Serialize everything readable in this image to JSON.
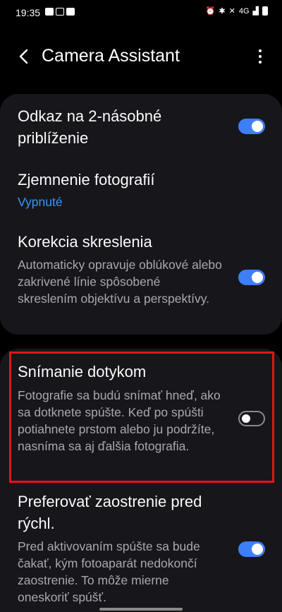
{
  "status_bar": {
    "time": "19:35",
    "network": "4G"
  },
  "header": {
    "title": "Camera Assistant"
  },
  "settings": [
    {
      "title": "Odkaz na 2-násobné priblíženie",
      "toggle": true
    },
    {
      "title": "Zjemnenie fotografií",
      "value": "Vypnuté"
    },
    {
      "title": "Korekcia skreslenia",
      "subtitle": "Automaticky opravuje oblúkové alebo zakrivené línie spôsobené skreslením objektívu a perspektívy.",
      "toggle": true
    },
    {
      "title": "Snímanie dotykom",
      "subtitle": "Fotografie sa budú snímať hneď, ako sa dotknete spúšte. Keď po spúšti potiahnete prstom alebo ju podržíte, nasníma sa aj ďalšia fotografia.",
      "toggle": false
    },
    {
      "title": "Preferovať zaostrenie pred rýchl.",
      "subtitle": "Pred aktivovaním spúšte sa bude čakať, kým fotoaparát nedokončí zaostrenie. To môže mierne oneskoriť spúšť.",
      "toggle": true
    }
  ],
  "colors": {
    "accent": "#3e7ef7",
    "value_text": "#3e91ff",
    "highlight": "#e0151b"
  }
}
